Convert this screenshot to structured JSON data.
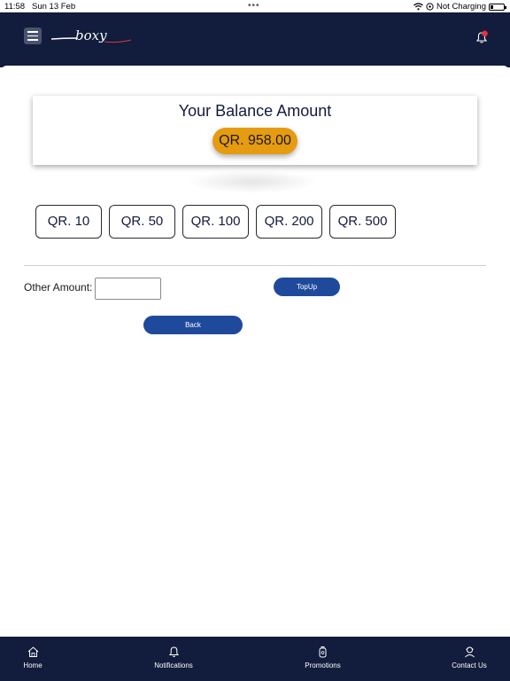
{
  "status_bar": {
    "time": "11:58",
    "date": "Sun 13 Feb",
    "charging": "Not Charging",
    "icons": [
      "wifi-icon",
      "location-icon",
      "battery-icon"
    ]
  },
  "header": {
    "logo_text": "boxy",
    "icons": [
      "menu-icon",
      "bell-icon"
    ],
    "colors": {
      "background": "#121c3c",
      "notification_dot": "#e8323c"
    }
  },
  "balance": {
    "title": "Your Balance Amount",
    "amount": "QR. 958.00",
    "pill_color": "#e69c10"
  },
  "amount_options": [
    {
      "label": "QR. 10"
    },
    {
      "label": "QR. 50"
    },
    {
      "label": "QR. 100"
    },
    {
      "label": "QR. 200"
    },
    {
      "label": "QR. 500"
    }
  ],
  "other_amount": {
    "label": "Other Amount:",
    "value": "",
    "placeholder": ""
  },
  "buttons": {
    "topup": "TopUp",
    "back": "Back",
    "color": "#1f4a9c"
  },
  "tab_bar": {
    "items": [
      {
        "label": "Home",
        "icon": "home-icon"
      },
      {
        "label": "Notifications",
        "icon": "bell-icon"
      },
      {
        "label": "Promotions",
        "icon": "promotions-icon"
      },
      {
        "label": "Contact Us",
        "icon": "contact-icon"
      }
    ]
  }
}
